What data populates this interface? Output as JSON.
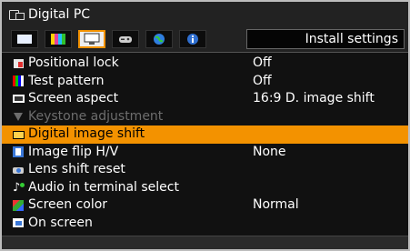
{
  "header": {
    "title": "Digital PC"
  },
  "tabs": [
    {
      "name": "tab-image-adjustment",
      "icon": "white-square-icon",
      "active": false
    },
    {
      "name": "tab-color-adjustment",
      "icon": "color-bars-icon",
      "active": false
    },
    {
      "name": "tab-install-settings",
      "icon": "projector-screen-icon",
      "active": true
    },
    {
      "name": "tab-system-settings",
      "icon": "gamepad-icon",
      "active": false
    },
    {
      "name": "tab-network-settings",
      "icon": "globe-icon",
      "active": false
    },
    {
      "name": "tab-information",
      "icon": "info-icon",
      "active": false
    }
  ],
  "section_label": "Install settings",
  "menu": [
    {
      "icon": "lock-icon",
      "label": "Positional lock",
      "value": "Off",
      "state": "normal"
    },
    {
      "icon": "test-pattern-icon",
      "label": "Test pattern",
      "value": "Off",
      "state": "normal"
    },
    {
      "icon": "screen-aspect-icon",
      "label": "Screen aspect",
      "value": "16:9 D. image shift",
      "state": "normal"
    },
    {
      "icon": "keystone-icon",
      "label": "Keystone adjustment",
      "value": "",
      "state": "disabled"
    },
    {
      "icon": "digital-image-shift-icon",
      "label": "Digital image shift",
      "value": "",
      "state": "selected"
    },
    {
      "icon": "image-flip-icon",
      "label": "Image flip H/V",
      "value": "None",
      "state": "normal"
    },
    {
      "icon": "lens-shift-icon",
      "label": "Lens shift reset",
      "value": "",
      "state": "normal"
    },
    {
      "icon": "audio-icon",
      "label": "Audio in terminal select",
      "value": "",
      "state": "normal"
    },
    {
      "icon": "screen-color-icon",
      "label": "Screen color",
      "value": "Normal",
      "state": "normal"
    },
    {
      "icon": "on-screen-icon",
      "label": "On screen",
      "value": "",
      "state": "normal"
    }
  ],
  "colors": {
    "highlight": "#f39200",
    "background": "#111111",
    "disabled_text": "#6d6d6d"
  }
}
